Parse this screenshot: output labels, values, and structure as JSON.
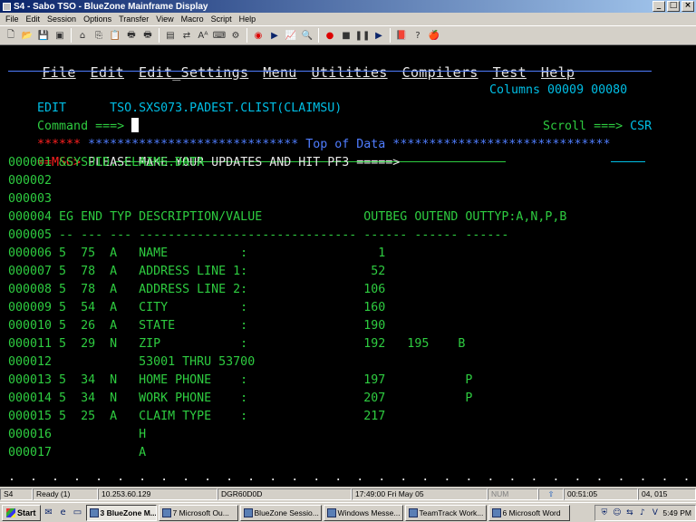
{
  "window": {
    "title": "S4 - Sabo TSO - BlueZone Mainframe Display",
    "buttons": [
      "_",
      "□",
      "×"
    ]
  },
  "menubar": [
    "File",
    "Edit",
    "Session",
    "Options",
    "Transfer",
    "View",
    "Macro",
    "Script",
    "Help"
  ],
  "toolbar_icons": [
    "new-icon",
    "open-icon",
    "save-icon",
    "disk-icon",
    "print-setup-icon",
    "copy-icon",
    "paste-icon",
    "print-icon",
    "print2-icon",
    "screen-icon",
    "transfer-icon",
    "font-icon",
    "keyboard-icon",
    "macro-icon",
    "record-icon",
    "play-icon",
    "graph-icon",
    "zoom-icon",
    "record-macro-icon",
    "stop-icon",
    "pause-icon",
    "play-macro-icon",
    "book-icon",
    "help-icon",
    "apple-icon"
  ],
  "toolbar_glyphs": [
    "🗋",
    "📂",
    "💾",
    "▣",
    "⌂",
    "⎘",
    "📋",
    "🖶",
    "🖶",
    "▤",
    "⇄",
    "Aᴬ",
    "⌨",
    "⚙",
    "◉",
    "▶",
    "📈",
    "🔍",
    "●",
    "■",
    "❚❚",
    "▶",
    "📕",
    "?",
    "🍎"
  ],
  "ispf_menu": [
    "File",
    "Edit",
    "Edit_Settings",
    "Menu",
    "Utilities",
    "Compilers",
    "Test",
    "Help"
  ],
  "header": {
    "mode": "EDIT",
    "dataset": "TSO.SXS073.PADEST.CLIST(CLAIMSU)",
    "columns": "Columns 00009 00080",
    "command_label": "Command ===>",
    "scroll_label": "Scroll ===>",
    "scroll_value": "CSR"
  },
  "top_line": {
    "prefix": "******",
    "text": " ***************************** Top of Data ******************************"
  },
  "msg_line": {
    "prefix": "==MSG>",
    "text": " PLEASE MAKE YOUR UPDATES AND HIT PF3 =====>"
  },
  "lines": [
    {
      "num": "000001",
      "text": " &SYSUID..CLAIMS.DATA"
    },
    {
      "num": "000002",
      "text": ""
    },
    {
      "num": "000003",
      "text": ""
    },
    {
      "num": "000004",
      "text": " EG END TYP DESCRIPTION/VALUE              OUTBEG OUTEND OUTTYP:A,N,P,B"
    },
    {
      "num": "000005",
      "text": " -- --- --- ------------------------------ ------ ------ ------"
    },
    {
      "num": "000006",
      "text": " 5  75  A   NAME          :                  1"
    },
    {
      "num": "000007",
      "text": " 5  78  A   ADDRESS LINE 1:                 52"
    },
    {
      "num": "000008",
      "text": " 5  78  A   ADDRESS LINE 2:                106"
    },
    {
      "num": "000009",
      "text": " 5  54  A   CITY          :                160"
    },
    {
      "num": "000010",
      "text": " 5  26  A   STATE         :                190"
    },
    {
      "num": "000011",
      "text": " 5  29  N   ZIP           :                192   195    B"
    },
    {
      "num": "000012",
      "text": "            53001 THRU 53700"
    },
    {
      "num": "000013",
      "text": " 5  34  N   HOME PHONE    :                197           P"
    },
    {
      "num": "000014",
      "text": " 5  34  N   WORK PHONE    :                207           P"
    },
    {
      "num": "000015",
      "text": " 5  25  A   CLAIM TYPE    :                217"
    },
    {
      "num": "000016",
      "text": "            H"
    },
    {
      "num": "000017",
      "text": "            A"
    }
  ],
  "dot_row": ".  .  .  .  .  .  .  .  .  .  .  .  .  .  .  .  .  .  .  .  .  .  .  .  .  .  .  .  .  .  .  .  .  .  .  .  .  .  .  .  .  .  .  .  .  .  .  .  .  .  .",
  "statusbar": {
    "session": "S4",
    "status": "Ready (1)",
    "host": "10.253.60.129",
    "lu": "DGR60D0D",
    "datetime": "17:49:00  Fri May 05",
    "num": "NUM",
    "elapsed": "00:51:05",
    "cursor_pos": "04, 015"
  },
  "taskbar": {
    "start": "Start",
    "tasks": [
      {
        "label": "3 BlueZone M...",
        "active": true
      },
      {
        "label": "7 Microsoft Ou...",
        "active": false
      },
      {
        "label": "BlueZone Sessio...",
        "active": false
      },
      {
        "label": "Windows Messe...",
        "active": false
      },
      {
        "label": "TeamTrack Work...",
        "active": false
      },
      {
        "label": "6 Microsoft Word",
        "active": false
      }
    ],
    "clock": "5:49 PM"
  }
}
